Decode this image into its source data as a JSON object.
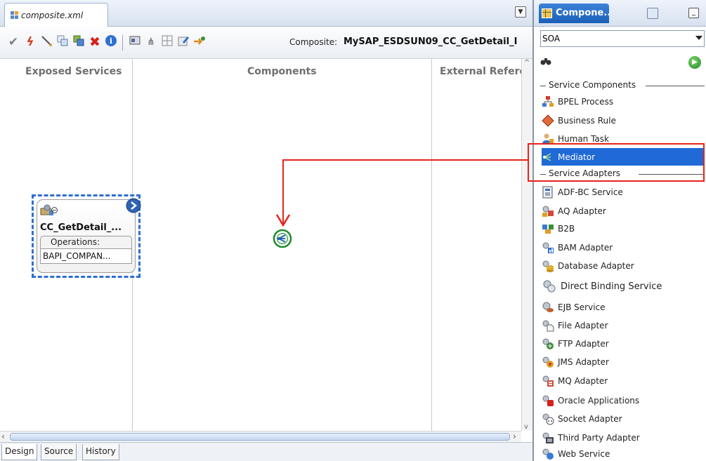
{
  "editor": {
    "file_tab": "composite.xml",
    "composite_label": "Composite:",
    "composite_name": "MySAP_ESDSUN09_CC_GetDetail_I",
    "columns": {
      "exposed": "Exposed Services",
      "components": "Components",
      "external": "External Refere"
    },
    "service": {
      "title": "CC_GetDetail_...",
      "operations_label": "Operations:",
      "operation": "BAPI_COMPAN..."
    },
    "bottom_tabs": [
      "Design",
      "Source",
      "History"
    ]
  },
  "palette": {
    "tab_title": "Compone...",
    "selector": "SOA",
    "search_placeholder": "",
    "groups": {
      "service_components": "Service Components",
      "service_adapters": "Service Adapters"
    },
    "components": [
      {
        "label": "BPEL Process",
        "icon": "bpel-process-icon"
      },
      {
        "label": "Business Rule",
        "icon": "business-rule-icon"
      },
      {
        "label": "Human Task",
        "icon": "human-task-icon"
      },
      {
        "label": "Mediator",
        "icon": "mediator-icon",
        "selected": true
      }
    ],
    "adapters": [
      {
        "label": "ADF-BC Service",
        "icon": "adf-bc-service-icon"
      },
      {
        "label": "AQ Adapter",
        "icon": "aq-adapter-icon"
      },
      {
        "label": "B2B",
        "icon": "b2b-icon"
      },
      {
        "label": "BAM Adapter",
        "icon": "bam-adapter-icon"
      },
      {
        "label": "Database Adapter",
        "icon": "database-adapter-icon"
      },
      {
        "label": "Direct Binding Service",
        "icon": "direct-binding-service-icon"
      },
      {
        "label": "EJB Service",
        "icon": "ejb-service-icon"
      },
      {
        "label": "File Adapter",
        "icon": "file-adapter-icon"
      },
      {
        "label": "FTP Adapter",
        "icon": "ftp-adapter-icon"
      },
      {
        "label": "JMS Adapter",
        "icon": "jms-adapter-icon"
      },
      {
        "label": "MQ Adapter",
        "icon": "mq-adapter-icon"
      },
      {
        "label": "Oracle Applications",
        "icon": "oracle-applications-icon"
      },
      {
        "label": "Socket Adapter",
        "icon": "socket-adapter-icon"
      },
      {
        "label": "Third Party Adapter",
        "icon": "third-party-adapter-icon"
      },
      {
        "label": "Web Service",
        "icon": "web-service-icon"
      }
    ]
  },
  "colors": {
    "selection": "#1f6ad6",
    "annotation": "#e8231c",
    "mediator": "#1d8a2a"
  }
}
